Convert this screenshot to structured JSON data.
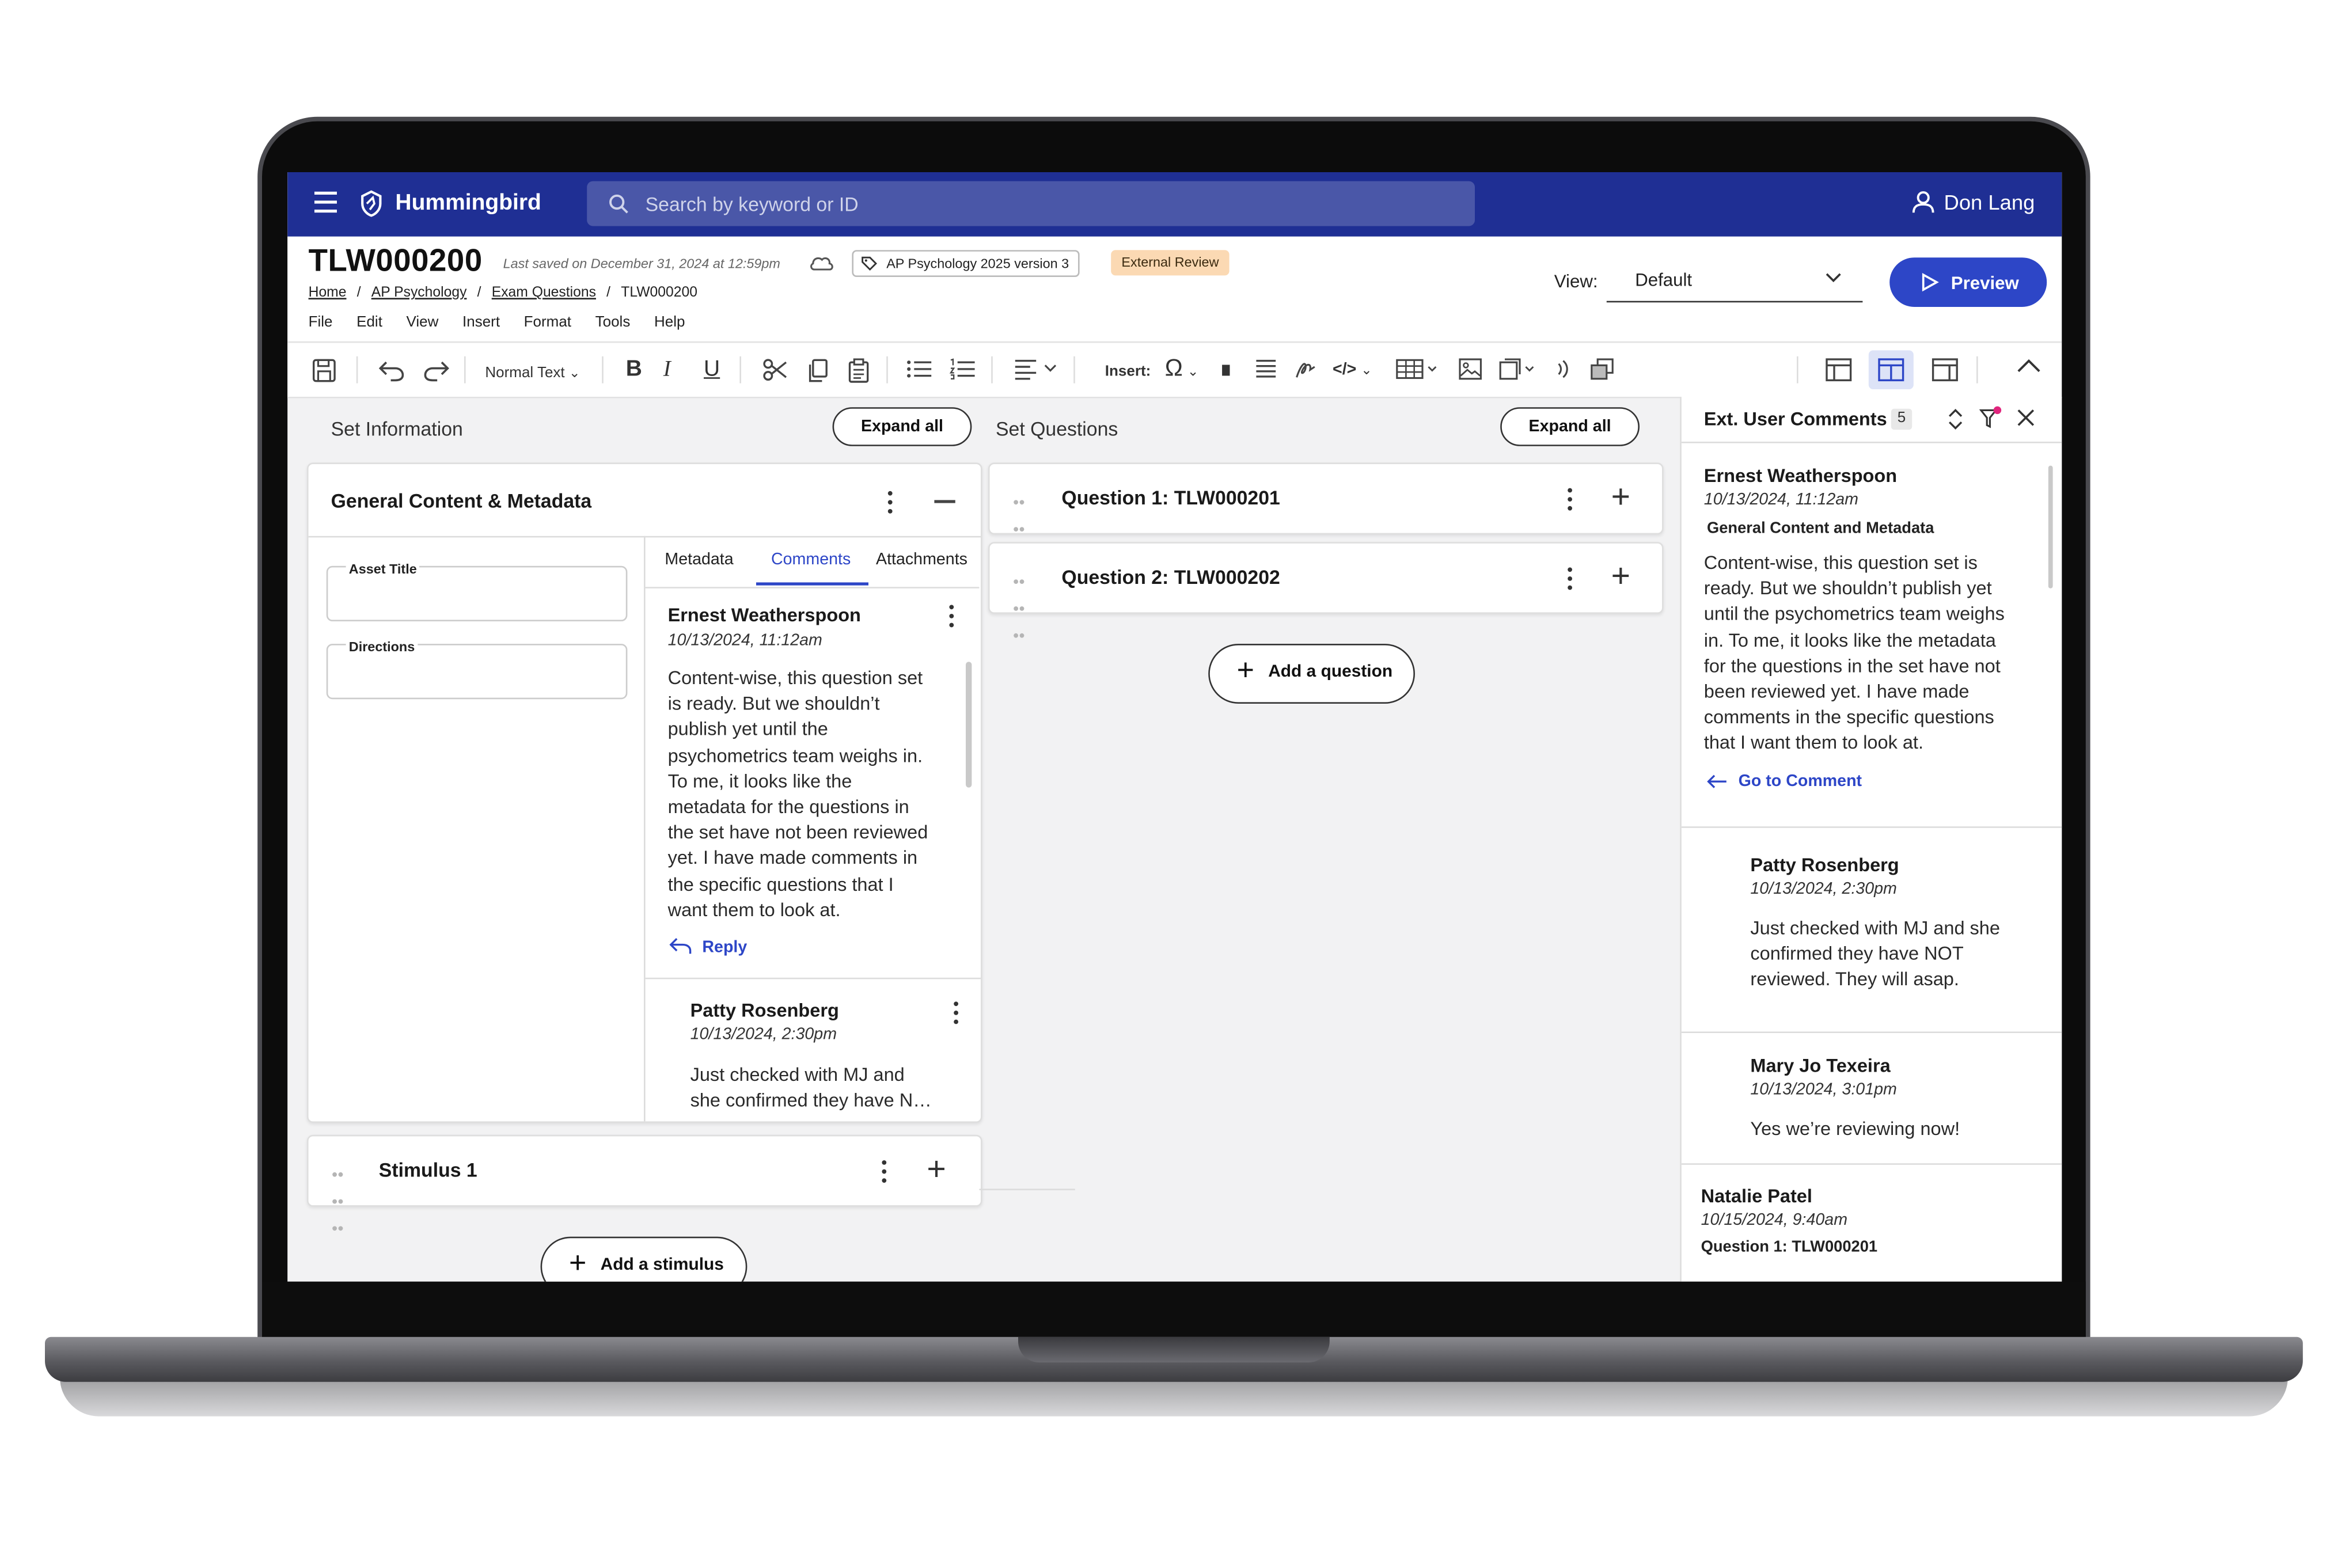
{
  "app": {
    "name": "Hummingbird",
    "search_placeholder": "Search by keyword or ID",
    "user": "Don Lang"
  },
  "doc": {
    "id": "TLW000200",
    "saved": "Last saved on December 31, 2024 at 12:59pm",
    "tag": "AP Psychology 2025 version 3",
    "status": "External Review",
    "breadcrumb": [
      "Home",
      "AP Psychology",
      "Exam Questions",
      "TLW000200"
    ],
    "menus": [
      "File",
      "Edit",
      "View",
      "Insert",
      "Format",
      "Tools",
      "Help"
    ],
    "view_label": "View:",
    "view_value": "Default",
    "preview": "Preview"
  },
  "toolbar": {
    "style": "Normal Text",
    "insert": "Insert:"
  },
  "left": {
    "title": "Set Information",
    "expand": "Expand all",
    "card_title": "General Content & Metadata",
    "fields": [
      "Asset Title",
      "Directions"
    ],
    "tabs": [
      "Metadata",
      "Comments",
      "Attachments"
    ],
    "comments": [
      {
        "name": "Ernest Weatherspoon",
        "date": "10/13/2024, 11:12am",
        "lines": [
          "Content-wise, this question set",
          "is ready. But we shouldn’t",
          "publish yet until the",
          "psychometrics team weighs in.",
          "To me, it looks like the",
          "metadata for the questions in",
          "the set have not been reviewed",
          "yet. I have made comments in",
          "the specific questions that I",
          "want them to look at."
        ]
      },
      {
        "name": "Patty Rosenberg",
        "date": "10/13/2024, 2:30pm",
        "lines": [
          "Just checked with MJ and",
          "she confirmed they have N…"
        ]
      }
    ],
    "reply": "Reply",
    "stimulus": "Stimulus 1",
    "add_stimulus": "Add a stimulus"
  },
  "middle": {
    "title": "Set Questions",
    "expand": "Expand all",
    "questions": [
      "Question 1: TLW000201",
      "Question 2: TLW000202"
    ],
    "add_question": "Add a question"
  },
  "right": {
    "title": "Ext. User Comments",
    "count": "5",
    "comments": [
      {
        "name": "Ernest Weatherspoon",
        "date": "10/13/2024, 11:12am",
        "context": "General Content and Metadata",
        "lines": [
          "Content-wise, this question set is",
          "ready. But we shouldn’t publish yet",
          "until the psychometrics team weighs",
          "in. To me, it looks like the metadata",
          "for the questions in the set have not",
          "been reviewed yet. I have made",
          "comments in the specific questions",
          "that I want them to look at."
        ]
      },
      {
        "name": "Patty Rosenberg",
        "date": "10/13/2024, 2:30pm",
        "lines": [
          "Just checked with MJ and she",
          "confirmed they have NOT",
          "reviewed. They will asap."
        ]
      },
      {
        "name": "Mary Jo Texeira",
        "date": "10/13/2024, 3:01pm",
        "lines": [
          "Yes we’re reviewing now!"
        ]
      },
      {
        "name": "Natalie Patel",
        "date": "10/15/2024, 9:40am",
        "context": "Question 1: TLW000201"
      }
    ],
    "goto": "Go to Comment"
  },
  "colors": {
    "header": "#1f2f94",
    "accent": "#2d46c7",
    "badge": "#fbd9b3"
  }
}
